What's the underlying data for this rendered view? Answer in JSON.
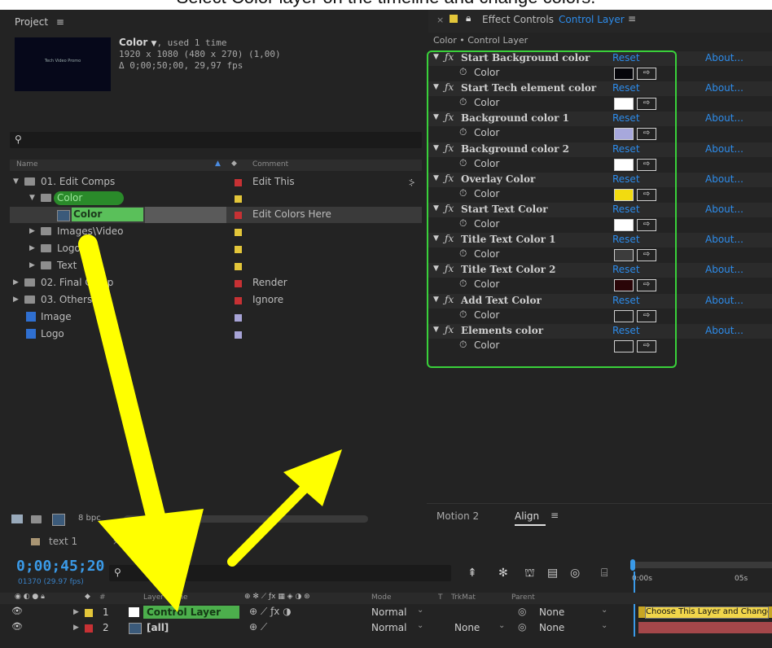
{
  "caption": "Select Color layer on the timeline and change colors.",
  "project_panel": {
    "title": "Project",
    "selected_item": {
      "name": "Color",
      "usage": ", used 1 time",
      "size": "1920 x 1080  (480 x 270) (1,00)",
      "duration": "Δ 0;00;50;00, 29,97 fps",
      "thumb_text": "Tech Video Promo"
    },
    "columns": {
      "name": "Name",
      "comment": "Comment"
    },
    "items": [
      {
        "name": "01. Edit Comps",
        "comment": "Edit This"
      },
      {
        "name": "Color",
        "comment": ""
      },
      {
        "name": "Color",
        "comment": "Edit Colors Here"
      },
      {
        "name": "Images\\Video",
        "comment": ""
      },
      {
        "name": "Logo",
        "comment": ""
      },
      {
        "name": "Text",
        "comment": ""
      },
      {
        "name": "02. Final Comp",
        "comment": "Render"
      },
      {
        "name": "03. Others",
        "comment": "Ignore"
      },
      {
        "name": "Image",
        "comment": ""
      },
      {
        "name": "Logo",
        "comment": ""
      }
    ],
    "bpc": "8 bpc"
  },
  "effect_controls": {
    "tab_title": "Effect Controls",
    "tab_layer": "Control Layer",
    "breadcrumb": "Color • Control Layer",
    "reset_label": "Reset",
    "about_label": "About...",
    "property_label": "Color",
    "effects": [
      {
        "name": "Start Background color",
        "swatch": "#05050a"
      },
      {
        "name": "Start Tech element color",
        "swatch": "#ffffff"
      },
      {
        "name": "Background color 1",
        "swatch": "#a7a8dc"
      },
      {
        "name": "Background color 2",
        "swatch": "#ffffff"
      },
      {
        "name": "Overlay Color",
        "swatch": "#f2db10"
      },
      {
        "name": "Start Text Color",
        "swatch": "#ffffff"
      },
      {
        "name": "Title Text Color 1",
        "swatch": "#3c3c3c"
      },
      {
        "name": "Title Text Color 2",
        "swatch": "#2a0508"
      },
      {
        "name": "Add Text Color",
        "swatch": "#232323"
      },
      {
        "name": "Elements color",
        "swatch": "#232323"
      }
    ]
  },
  "bottom_tabs": {
    "motion": "Motion 2",
    "align": "Align"
  },
  "timeline": {
    "tab_text": "text 1",
    "timecode": "0;00;45;20",
    "frame_info": "01370 (29.97 fps)",
    "headers": {
      "num": "#",
      "layer_name": "Layer Name",
      "mode": "Mode",
      "t": "T",
      "trkmat": "TrkMat",
      "parent": "Parent"
    },
    "ruler": {
      "start": "0:00s",
      "mark": "05s"
    },
    "layers": [
      {
        "num": "1",
        "name": "Control Layer",
        "mode": "Normal",
        "trkmat": "",
        "parent": "None",
        "bar_text": "Choose This Layer and Change"
      },
      {
        "num": "2",
        "name": "[all]",
        "mode": "Normal",
        "trkmat": "None",
        "parent": "None",
        "bar_text": ""
      }
    ]
  },
  "colors": {
    "accent_blue": "#2d8ceb",
    "highlight_green": "#39d03a",
    "arrow_yellow": "#ffff00"
  }
}
